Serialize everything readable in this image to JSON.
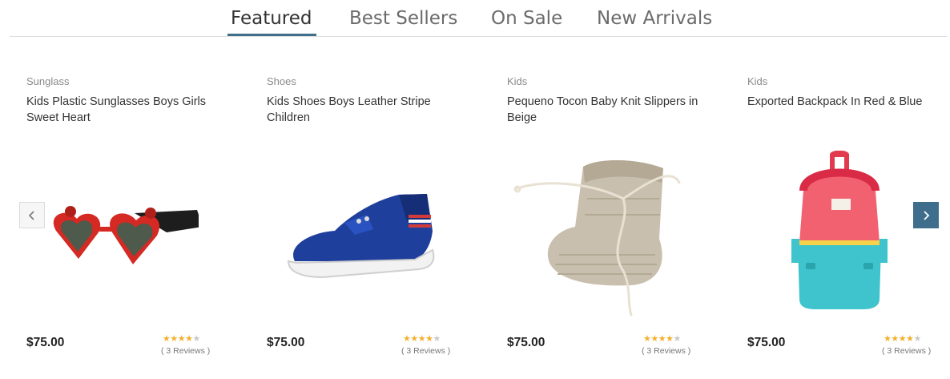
{
  "tabs": [
    {
      "label": "Featured",
      "active": true
    },
    {
      "label": "Best Sellers",
      "active": false
    },
    {
      "label": "On Sale",
      "active": false
    },
    {
      "label": "New Arrivals",
      "active": false
    }
  ],
  "colors": {
    "accent": "#3f6e8c",
    "star": "#f4b02c",
    "star_empty": "#c9c9c9"
  },
  "products": [
    {
      "category": "Sunglass",
      "title": "Kids Plastic Sunglasses Boys Girls Sweet Heart",
      "price": "$75.00",
      "rating": 4,
      "rating_max": 5,
      "reviews": "( 3 Reviews )",
      "image_icon": "heart-sunglasses-image"
    },
    {
      "category": "Shoes",
      "title": "Kids Shoes Boys Leather Stripe Children",
      "price": "$75.00",
      "rating": 4,
      "rating_max": 5,
      "reviews": "( 3 Reviews )",
      "image_icon": "blue-shoe-image"
    },
    {
      "category": "Kids",
      "title": "Pequeno Tocon Baby Knit Slippers in Beige",
      "price": "$75.00",
      "rating": 4,
      "rating_max": 5,
      "reviews": "( 3 Reviews )",
      "image_icon": "knit-slipper-image"
    },
    {
      "category": "Kids",
      "title": "Exported Backpack In Red & Blue",
      "price": "$75.00",
      "rating": 4,
      "rating_max": 5,
      "reviews": "( 3 Reviews )",
      "image_icon": "backpack-image"
    }
  ],
  "nav": {
    "prev_icon": "chevron-left-icon",
    "next_icon": "chevron-right-icon"
  }
}
